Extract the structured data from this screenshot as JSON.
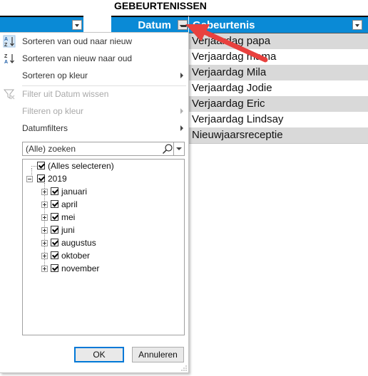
{
  "sheet": {
    "title": "GEBEURTENISSEN",
    "headers": {
      "datum": "Datum",
      "event": "Gebeurtenis"
    },
    "rows": [
      "Verjaardag papa",
      "Verjaardag mama",
      "Verjaardag Mila",
      "Verjaardag Jodie",
      "Verjaardag Eric",
      "Verjaardag Lindsay",
      "Nieuwjaarsreceptie"
    ],
    "header_color": "#0a8ad6",
    "band_color": "#d9d9d9"
  },
  "menu": {
    "sort_asc": "Sorteren van oud naar nieuw",
    "sort_desc": "Sorteren van nieuw naar oud",
    "sort_color": "Sorteren op kleur",
    "clear_filter": "Filter uit Datum wissen",
    "filter_color": "Filteren op kleur",
    "date_filters": "Datumfilters",
    "search_placeholder": "(Alle) zoeken",
    "tree": {
      "select_all": "(Alles selecteren)",
      "year": "2019",
      "months": [
        "januari",
        "april",
        "mei",
        "juni",
        "augustus",
        "oktober",
        "november"
      ]
    },
    "ok": "OK",
    "cancel": "Annuleren"
  },
  "icons": [
    "sort-ascending-icon",
    "sort-descending-icon",
    "clear-filter-icon",
    "search-icon",
    "dropdown-arrow-icon",
    "annotation-arrow-icon"
  ],
  "accent_color": "#0078d7",
  "annotation_color": "#e8413e"
}
